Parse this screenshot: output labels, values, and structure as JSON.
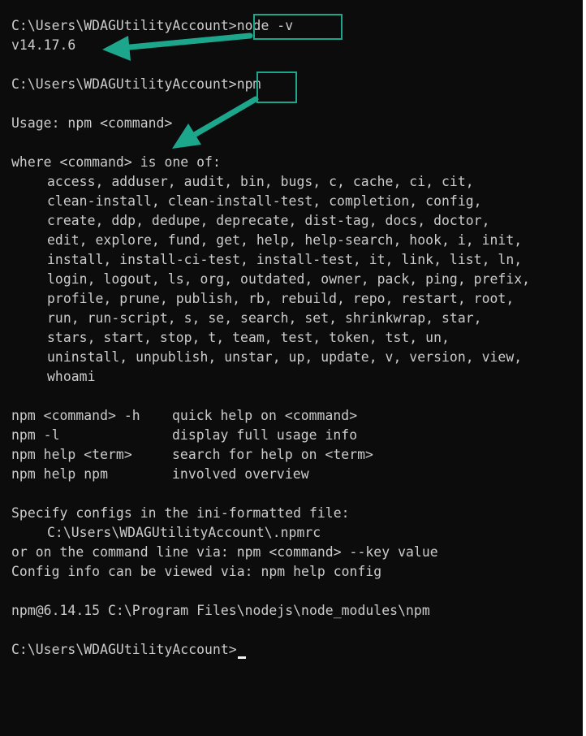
{
  "terminal": {
    "prompt": "C:\\Users\\WDAGUtilityAccount>",
    "cmd1": "node -v",
    "cmd1_output": "v14.17.6",
    "cmd2": "npm",
    "usage": "Usage: npm <command>",
    "where_line": "where <command> is one of:",
    "commands_lines": [
      "access, adduser, audit, bin, bugs, c, cache, ci, cit,",
      "clean-install, clean-install-test, completion, config,",
      "create, ddp, dedupe, deprecate, dist-tag, docs, doctor,",
      "edit, explore, fund, get, help, help-search, hook, i, init,",
      "install, install-ci-test, install-test, it, link, list, ln,",
      "login, logout, ls, org, outdated, owner, pack, ping, prefix,",
      "profile, prune, publish, rb, rebuild, repo, restart, root,",
      "run, run-script, s, se, search, set, shrinkwrap, star,",
      "stars, start, stop, t, team, test, token, tst, un,",
      "uninstall, unpublish, unstar, up, update, v, version, view,",
      "whoami"
    ],
    "help_rows": [
      {
        "cmd": "npm <command> -h",
        "desc": "quick help on <command>"
      },
      {
        "cmd": "npm -l",
        "desc": "display full usage info"
      },
      {
        "cmd": "npm help <term>",
        "desc": "search for help on <term>"
      },
      {
        "cmd": "npm help npm",
        "desc": "involved overview"
      }
    ],
    "config_intro": "Specify configs in the ini-formatted file:",
    "config_path": "C:\\Users\\WDAGUtilityAccount\\.npmrc",
    "config_cli": "or on the command line via: npm <command> --key value",
    "config_view": "Config info can be viewed via: npm help config",
    "npm_location": "npm@6.14.15 C:\\Program Files\\nodejs\\node_modules\\npm"
  },
  "colors": {
    "background": "#0c0c0c",
    "text": "#cccccc",
    "annotation": "#1ca68c"
  }
}
